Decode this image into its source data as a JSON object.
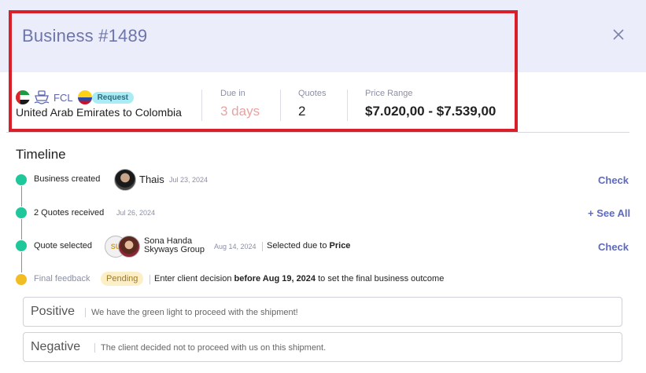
{
  "header": {
    "title": "Business #1489"
  },
  "summary": {
    "mode": "FCL",
    "badge": "Request",
    "route": "United Arab Emirates to Colombia",
    "due_label": "Due in",
    "due_value": "3 days",
    "quotes_label": "Quotes",
    "quotes_value": "2",
    "price_label": "Price Range",
    "price_value": "$7.020,00 - $7.539,00"
  },
  "timeline": {
    "title": "Timeline",
    "created": {
      "label": "Business created",
      "user": "Thais",
      "date": "Jul 23, 2024",
      "action": "Check"
    },
    "quotes": {
      "label": "2 Quotes received",
      "date": "Jul 26, 2024",
      "action": "+ See All"
    },
    "selected": {
      "label": "Quote selected",
      "logo_text": "SU",
      "user": "Sona Handa",
      "company": "Skyways Group",
      "date": "Aug 14, 2024",
      "reason_prefix": "Selected due to",
      "reason": "Price",
      "action": "Check"
    },
    "feedback": {
      "label": "Final feedback",
      "status": "Pending",
      "text_prefix": "Enter client decision",
      "text_bold": "before Aug 19, 2024",
      "text_suffix": "to set the final business outcome"
    }
  },
  "options": [
    {
      "title": "Positive",
      "description": "We have the green light to proceed with the shipment!"
    },
    {
      "title": "Negative",
      "description": "The client decided not to proceed with us on this shipment."
    }
  ],
  "colors": {
    "accent": "#5e6ac0",
    "header_bg": "#ecedfb",
    "highlight": "#d9202a",
    "timeline_green": "#1fc79a",
    "pending_yellow": "#f2bd22",
    "due_text": "#e7a3a3",
    "badge_bg": "#a9ecf3"
  },
  "icons": {
    "close": "close-icon",
    "ship": "ship-icon",
    "origin_flag": "uae-flag-icon",
    "destination_flag": "colombia-flag-icon"
  }
}
